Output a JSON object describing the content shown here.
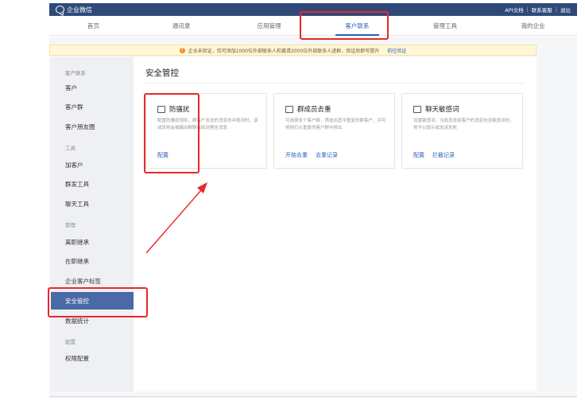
{
  "app": {
    "title": "企业微信"
  },
  "topbar": {
    "links": [
      "API文档",
      "联系客服",
      "退出"
    ]
  },
  "nav": {
    "tabs": [
      "首页",
      "通讯录",
      "应用管理",
      "客户联系",
      "管理工具",
      "我的企业"
    ],
    "active_index": 3
  },
  "notice": {
    "icon": "warning-icon",
    "text": "企业未验证，仅可添加1000位外部联系人和邀请2000位外部联系人进群，验证后即可提升",
    "link": "前往验证"
  },
  "sidebar": {
    "items": [
      {
        "label": "客户联系",
        "type": "group"
      },
      {
        "label": "客户",
        "type": "item"
      },
      {
        "label": "客户群",
        "type": "item"
      },
      {
        "label": "客户朋友圈",
        "type": "item"
      },
      {
        "label": "工具",
        "type": "group"
      },
      {
        "label": "加客户",
        "type": "item"
      },
      {
        "label": "群发工具",
        "type": "item"
      },
      {
        "label": "聊天工具",
        "type": "item"
      },
      {
        "label": "管理",
        "type": "group"
      },
      {
        "label": "离职继承",
        "type": "item"
      },
      {
        "label": "在职继承",
        "type": "item"
      },
      {
        "label": "企业客户标签",
        "type": "item"
      },
      {
        "label": "安全管控",
        "type": "item",
        "active": true
      },
      {
        "label": "数据统计",
        "type": "item"
      },
      {
        "label": "配置",
        "type": "group"
      },
      {
        "label": "权限配置",
        "type": "item"
      }
    ]
  },
  "main": {
    "title": "安全管控",
    "cards": [
      {
        "title": "防骚扰",
        "icon": "anti-harassment-icon",
        "desc": "配置防骚扰规则，群客户发送的消息命中规则时，该成员将会被踢出群聊或收到警告消息",
        "links": [
          "配置"
        ]
      },
      {
        "title": "群成员去重",
        "icon": "dedupe-icon",
        "desc": "可选择多个客户群，筛选出其中重复的群客户，并可将他们从重复的客户群中移出",
        "links": [
          "开始去重",
          "去重记录"
        ]
      },
      {
        "title": "聊天敏感词",
        "icon": "sensitive-word-icon",
        "desc": "设置敏感词，当成员发给客户的消息包含敏感词时，将予以提示或发送失败",
        "links": [
          "配置",
          "拦截记录"
        ]
      }
    ]
  },
  "colors": {
    "topbar": "#2f4a79",
    "accent": "#2a5ebd",
    "active_sidebar": "#4a6aa6",
    "highlight": "#e8282b",
    "notice_bg": "#fff7d5"
  }
}
